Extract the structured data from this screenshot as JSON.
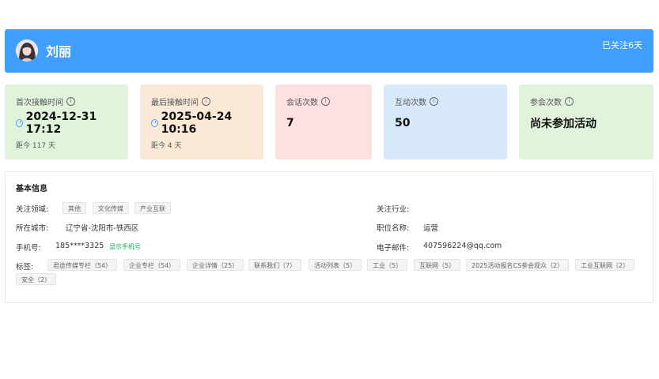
{
  "header": {
    "name": "刘丽",
    "follow_days": "已关注6天",
    "colors": {
      "bar": "#409eff"
    }
  },
  "stats": [
    {
      "title": "首次接触时间",
      "value": "2024-12-31 17:12",
      "sub": "距今 117 天",
      "bg": "#e2f3dc",
      "clock": true
    },
    {
      "title": "最后接触时间",
      "value": "2025-04-24 10:16",
      "sub": "距今 4 天",
      "bg": "#fbe9d8",
      "clock": true
    },
    {
      "title": "会话次数",
      "value": "7",
      "sub": "",
      "bg": "#fde1e1",
      "clock": false
    },
    {
      "title": "互动次数",
      "value": "50",
      "sub": "",
      "bg": "#d9e9fc",
      "clock": false
    },
    {
      "title": "参会次数",
      "value": "尚未参加活动",
      "sub": "",
      "bg": "#e2f3dc",
      "clock": false
    }
  ],
  "basic": {
    "title": "基本信息",
    "focus_area_label": "关注领域:",
    "focus_areas": [
      "其他",
      "文化传媒",
      "产业互联"
    ],
    "industry_label": "关注行业:",
    "industry_value": "",
    "city_label": "所在城市:",
    "city_value": "辽宁省-沈阳市-铁西区",
    "position_label": "职位名称:",
    "position_value": "运营",
    "phone_label": "手机号:",
    "phone_value": "185****3325",
    "show_phone": "显示手机号",
    "email_label": "电子邮件:",
    "email_value": "407596224@qq.com",
    "tags_label": "标签:",
    "tags": [
      "君途传媒专栏（54）",
      "企业专栏（54）",
      "企业详情（25）",
      "联系我们（7）",
      "活动列表（5）",
      "工业（5）",
      "互联网（5）",
      "2025活动报名CS参会观众（2）",
      "工业互联网（2）",
      "安全（2）"
    ]
  }
}
